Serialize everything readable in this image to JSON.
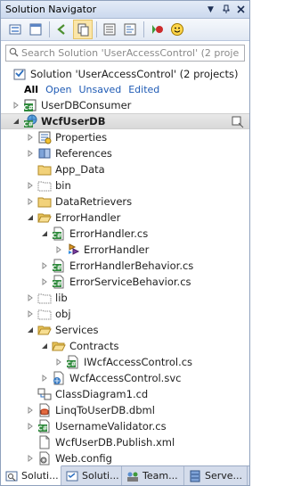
{
  "window": {
    "title": "Solution Navigator"
  },
  "search": {
    "placeholder": "Search Solution 'UserAccessControl' (2 proje"
  },
  "solution": {
    "label": "Solution 'UserAccessControl' (2 projects)"
  },
  "filters": [
    "All",
    "Open",
    "Unsaved",
    "Edited"
  ],
  "tree": [
    {
      "label": "UserDBConsumer",
      "indent": 0,
      "expander": "collapsed",
      "icon": "csharp-project-icon"
    },
    {
      "label": "WcfUserDB",
      "indent": 0,
      "expander": "expanded",
      "icon": "csharp-web-project-icon",
      "bold": true,
      "selected": true,
      "right_icon": "properties-pin-icon"
    },
    {
      "label": "Properties",
      "indent": 1,
      "expander": "collapsed",
      "icon": "properties-icon"
    },
    {
      "label": "References",
      "indent": 1,
      "expander": "collapsed",
      "icon": "references-icon"
    },
    {
      "label": "App_Data",
      "indent": 1,
      "expander": "none",
      "icon": "folder-icon"
    },
    {
      "label": "bin",
      "indent": 1,
      "expander": "collapsed",
      "icon": "hidden-folder-icon"
    },
    {
      "label": "DataRetrievers",
      "indent": 1,
      "expander": "collapsed",
      "icon": "folder-icon"
    },
    {
      "label": "ErrorHandler",
      "indent": 1,
      "expander": "expanded",
      "icon": "open-folder-icon"
    },
    {
      "label": "ErrorHandler.cs",
      "indent": 2,
      "expander": "expanded",
      "icon": "csharp-file-icon"
    },
    {
      "label": "ErrorHandler",
      "indent": 3,
      "expander": "collapsed",
      "icon": "class-icon"
    },
    {
      "label": "ErrorHandlerBehavior.cs",
      "indent": 2,
      "expander": "collapsed",
      "icon": "csharp-file-icon"
    },
    {
      "label": "ErrorServiceBehavior.cs",
      "indent": 2,
      "expander": "collapsed",
      "icon": "csharp-file-icon"
    },
    {
      "label": "lib",
      "indent": 1,
      "expander": "collapsed",
      "icon": "hidden-folder-icon"
    },
    {
      "label": "obj",
      "indent": 1,
      "expander": "collapsed",
      "icon": "hidden-folder-icon"
    },
    {
      "label": "Services",
      "indent": 1,
      "expander": "expanded",
      "icon": "open-folder-icon"
    },
    {
      "label": "Contracts",
      "indent": 2,
      "expander": "expanded",
      "icon": "open-folder-icon"
    },
    {
      "label": "IWcfAccessControl.cs",
      "indent": 3,
      "expander": "collapsed",
      "icon": "csharp-file-icon"
    },
    {
      "label": "WcfAccessControl.svc",
      "indent": 2,
      "expander": "collapsed",
      "icon": "svc-file-icon"
    },
    {
      "label": "ClassDiagram1.cd",
      "indent": 1,
      "expander": "none",
      "icon": "class-diagram-icon"
    },
    {
      "label": "LinqToUserDB.dbml",
      "indent": 1,
      "expander": "collapsed",
      "icon": "dbml-icon"
    },
    {
      "label": "UsernameValidator.cs",
      "indent": 1,
      "expander": "collapsed",
      "icon": "csharp-file-icon"
    },
    {
      "label": "WcfUserDB.Publish.xml",
      "indent": 1,
      "expander": "none",
      "icon": "xml-file-icon"
    },
    {
      "label": "Web.config",
      "indent": 1,
      "expander": "collapsed",
      "icon": "config-file-icon"
    }
  ],
  "tabs": [
    {
      "label": "Soluti...",
      "icon": "solution-navigator-tab-icon",
      "active": true
    },
    {
      "label": "Soluti...",
      "icon": "solution-explorer-tab-icon"
    },
    {
      "label": "Team...",
      "icon": "team-explorer-tab-icon"
    },
    {
      "label": "Serve...",
      "icon": "server-explorer-tab-icon"
    }
  ],
  "colors": {
    "accent": "#1e5ab4",
    "folder": "#e8c45a",
    "csharp": "#2f8a3c"
  }
}
